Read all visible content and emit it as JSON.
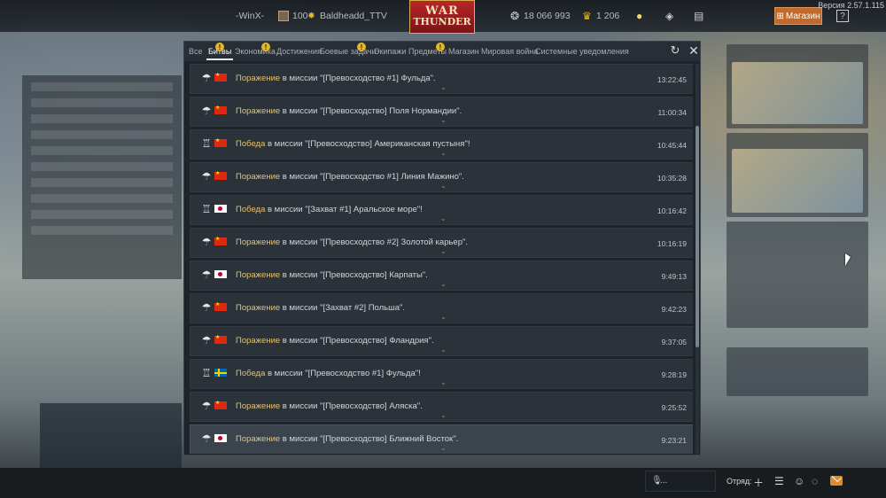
{
  "version": "Версия 2.57.1.115",
  "topbar": {
    "clan_name": "-WinX-",
    "level": "100",
    "player": "Baldheadd_TTV",
    "silver_lions": "18 066 993",
    "golden_eagles": "1 206",
    "shop_label": "Магазин",
    "help_label": "?"
  },
  "logo": {
    "line1": "WAR",
    "line2": "THUNDER"
  },
  "tabs": [
    {
      "label": "Все",
      "badge": ""
    },
    {
      "label": "Битвы",
      "badge": "!"
    },
    {
      "label": "Экономика",
      "badge": ""
    },
    {
      "label": "Достижения",
      "badge": "!"
    },
    {
      "label": "Боевые задачи",
      "badge": ""
    },
    {
      "label": "Экипажи",
      "badge": "!"
    },
    {
      "label": "Предметы",
      "badge": ""
    },
    {
      "label": "Магазин",
      "badge": "!"
    },
    {
      "label": "Мировая война",
      "badge": ""
    },
    {
      "label": "Системные уведомления",
      "badge": ""
    }
  ],
  "active_tab": "Битвы",
  "connector": "в миссии",
  "battles": [
    {
      "result": "Поражение",
      "mission": "\"[Превосходство #1] Фульда\".",
      "time": "13:22:45",
      "icon": "parachute-icon",
      "nation": "cn"
    },
    {
      "result": "Поражение",
      "mission": "\"[Превосходство] Поля Нормандии\".",
      "time": "11:00:34",
      "icon": "parachute-icon",
      "nation": "cn"
    },
    {
      "result": "Победа",
      "mission": "\"[Превосходство] Американская пустыня\"!",
      "time": "10:45:44",
      "icon": "trophy-icon",
      "nation": "cn"
    },
    {
      "result": "Поражение",
      "mission": "\"[Превосходство #1] Линия Мажино\".",
      "time": "10:35:28",
      "icon": "parachute-icon",
      "nation": "cn"
    },
    {
      "result": "Победа",
      "mission": "\"[Захват #1] Аральское море\"!",
      "time": "10:16:42",
      "icon": "trophy-icon",
      "nation": "jp"
    },
    {
      "result": "Поражение",
      "mission": "\"[Превосходство #2] Золотой карьер\".",
      "time": "10:16:19",
      "icon": "parachute-icon",
      "nation": "cn"
    },
    {
      "result": "Поражение",
      "mission": "\"[Превосходство] Карпаты\".",
      "time": "9:49:13",
      "icon": "parachute-icon",
      "nation": "jp"
    },
    {
      "result": "Поражение",
      "mission": "\"[Захват #2] Польша\".",
      "time": "9:42:23",
      "icon": "parachute-icon",
      "nation": "cn"
    },
    {
      "result": "Поражение",
      "mission": "\"[Превосходство] Фландрия\".",
      "time": "9:37:05",
      "icon": "parachute-icon",
      "nation": "cn"
    },
    {
      "result": "Победа",
      "mission": "\"[Превосходство #1] Фульда\"!",
      "time": "9:28:19",
      "icon": "trophy-icon",
      "nation": "se"
    },
    {
      "result": "Поражение",
      "mission": "\"[Превосходство] Аляска\".",
      "time": "9:25:52",
      "icon": "parachute-icon",
      "nation": "cn"
    },
    {
      "result": "Поражение",
      "mission": "\"[Превосходство] Ближний Восток\".",
      "time": "9:23:21",
      "icon": "parachute-icon",
      "nation": "jp"
    }
  ],
  "bottombar": {
    "voice_placeholder": "...",
    "squad_label": "Отряд:"
  },
  "colors": {
    "result_accent": "#e3c26e",
    "badge": "#e2b826",
    "shop": "#c26a2d",
    "mail": "#e08a2c"
  }
}
